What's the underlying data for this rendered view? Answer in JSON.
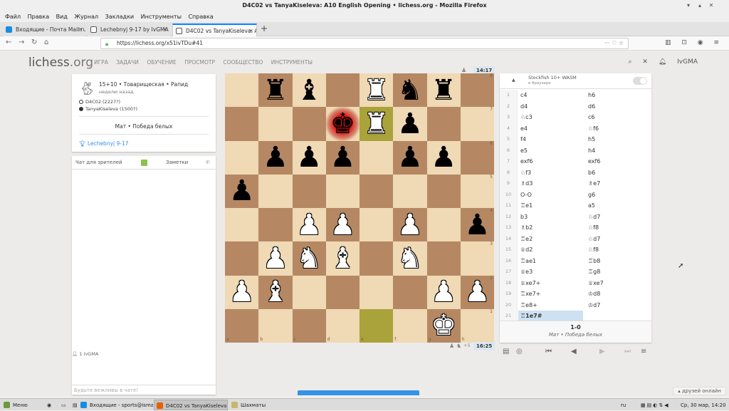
{
  "window_title": "D4C02 vs TanyaKiseleva: A10 English Opening • lichess.org - Mozilla Firefox",
  "menu": [
    "Файл",
    "Правка",
    "Вид",
    "Журнал",
    "Закладки",
    "Инструменты",
    "Справка"
  ],
  "tabs": [
    {
      "label": "Входящие - Почта Mail.ru",
      "color": "#168de2"
    },
    {
      "label": "Lechebnyj 9-17 by IvGMA • li",
      "color": "#555"
    },
    {
      "label": "D4C02 vs TanyaKiseleva: A10",
      "color": "#555"
    }
  ],
  "url": "https://lichess.org/x51ivTDu#41",
  "site": {
    "logo_main": "lichess",
    "logo_tld": ".org",
    "nav": [
      "ИГРА",
      "ЗАДАЧИ",
      "ОБУЧЕНИЕ",
      "ПРОСМОТР",
      "СООБЩЕСТВО",
      "ИНСТРУМЕНТЫ"
    ],
    "user": "IvGMA"
  },
  "game_info": {
    "line1": "15+10 • Товарищеская • Рапид",
    "line2": "неделю назад",
    "white_player": "D4C02 (2227?)",
    "black_player": "TanyaKiseleva (1500?)",
    "result": "Мат • Победа белых",
    "tournament": "Lechebnyj 9-17"
  },
  "chat": {
    "tab1": "Чат для зрителей",
    "tab2": "Заметки",
    "placeholder": "Будьте вежливы в чате!"
  },
  "watchers": "1 IvGMA",
  "clocks": {
    "top": "14:17",
    "bottom": "16:25",
    "bottom_extra": "+5"
  },
  "board": [
    [
      "",
      "r",
      "b",
      "",
      "R",
      "n",
      "r",
      ""
    ],
    [
      "",
      "",
      "",
      "k",
      "R",
      "p",
      "",
      ""
    ],
    [
      "",
      "p",
      "p",
      "p",
      "",
      "p",
      "p",
      ""
    ],
    [
      "p",
      "",
      "",
      "",
      "",
      "",
      "",
      ""
    ],
    [
      "",
      "",
      "P",
      "P",
      "",
      "P",
      "",
      "p"
    ],
    [
      "",
      "P",
      "N",
      "B",
      "",
      "N",
      "",
      ""
    ],
    [
      "P",
      "B",
      "",
      "",
      "",
      "",
      "P",
      "P"
    ],
    [
      "",
      "",
      "",
      "",
      "",
      "",
      "K",
      ""
    ]
  ],
  "last_move": [
    "e1",
    "e7"
  ],
  "check_square": "d7",
  "ranks": [
    "8",
    "7",
    "6",
    "5",
    "4",
    "3",
    "2",
    "1"
  ],
  "files": [
    "a",
    "b",
    "c",
    "d",
    "e",
    "f",
    "g",
    "h"
  ],
  "engine": {
    "name": "Stockfish 10+ WASM",
    "sub": "в браузере"
  },
  "moves": [
    [
      "c4",
      "h6"
    ],
    [
      "d4",
      "d6"
    ],
    [
      "♘c3",
      "c6"
    ],
    [
      "e4",
      "♘f6"
    ],
    [
      "f4",
      "h5"
    ],
    [
      "e5",
      "h4"
    ],
    [
      "exf6",
      "exf6"
    ],
    [
      "♘f3",
      "b6"
    ],
    [
      "♗d3",
      "♗e7"
    ],
    [
      "O-O",
      "g6"
    ],
    [
      "♖e1",
      "a5"
    ],
    [
      "b3",
      "♘d7"
    ],
    [
      "♗b2",
      "♘f8"
    ],
    [
      "♖e2",
      "♘d7"
    ],
    [
      "♕d2",
      "♘f8"
    ],
    [
      "♖ae1",
      "♖b8"
    ],
    [
      "♕e3",
      "♖g8"
    ],
    [
      "♕xe7+",
      "♕xe7"
    ],
    [
      "♖xe7+",
      "♔d8"
    ],
    [
      "♖e8+",
      "♔d7"
    ],
    [
      "♖1e7#",
      ""
    ]
  ],
  "result": {
    "score": "1-0",
    "text": "Мат • Победа белых"
  },
  "online_friends": "друзей онлайн",
  "taskbar": {
    "menu": "Меню",
    "items": [
      "Входящие - sports@isma.i...",
      "D4C02 vs TanyaKiseleva: A...",
      "Шахматы"
    ],
    "lang": "ru",
    "clock": "Ср, 30 мар, 14:20"
  }
}
